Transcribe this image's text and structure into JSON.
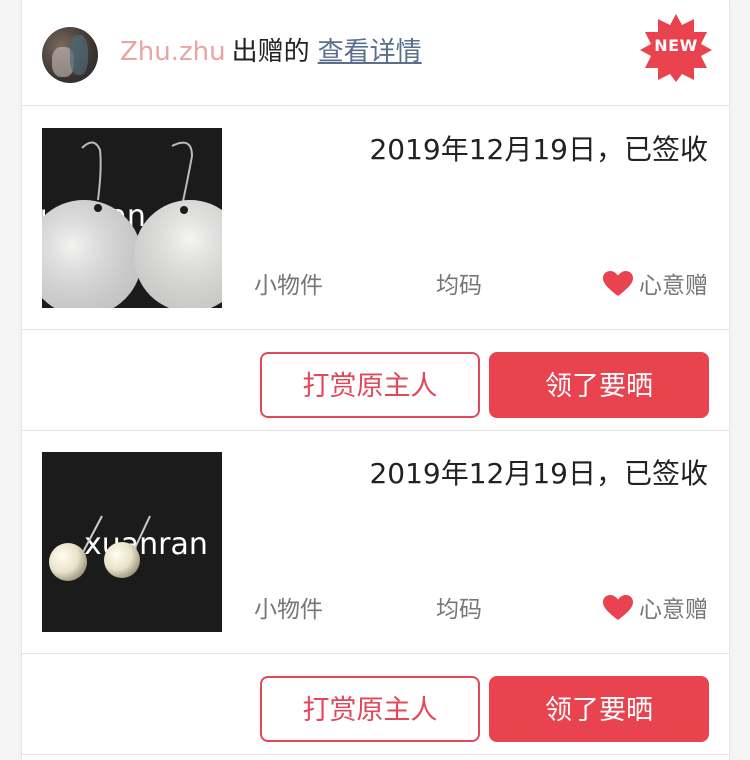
{
  "header": {
    "username": "Zhu.zhu",
    "gave_text": "出赠的",
    "detail_link": "查看详情",
    "badge": "NEW",
    "badge_color": "#e8434f"
  },
  "items": [
    {
      "date_status": "2019年12月19日，已签收",
      "category": "小物件",
      "size": "均码",
      "gift_type": "心意赠",
      "image_text": "xuanran",
      "reward_button": "打赏原主人",
      "claim_button": "领了要晒"
    },
    {
      "date_status": "2019年12月19日，已签收",
      "category": "小物件",
      "size": "均码",
      "gift_type": "心意赠",
      "image_text": "xuanran",
      "reward_button": "打赏原主人",
      "claim_button": "领了要晒"
    }
  ],
  "colors": {
    "accent": "#e8434f",
    "username": "#eaa4a4",
    "link": "#5a6f8e"
  }
}
